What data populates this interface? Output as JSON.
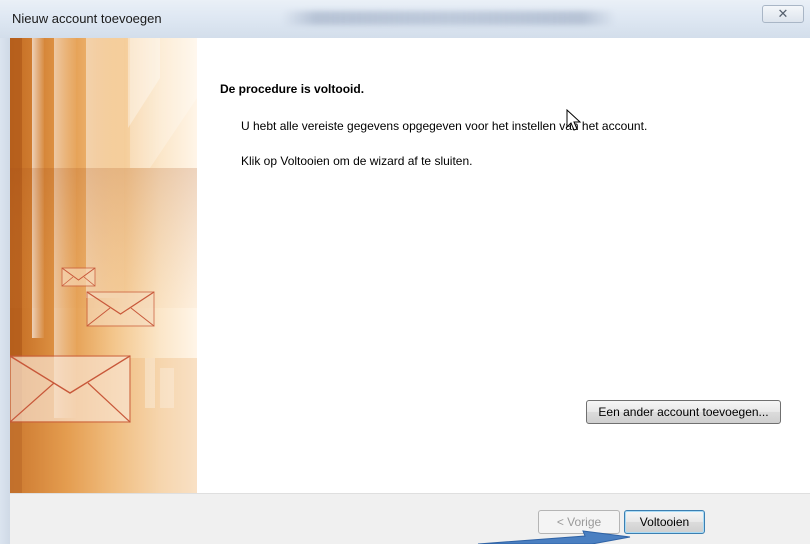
{
  "window": {
    "title": "Nieuw account toevoegen",
    "close_glyph": "✕",
    "close_icon": "close-icon"
  },
  "main": {
    "heading": "De procedure is voltooid.",
    "paragraph_1": "U hebt alle vereiste gegevens opgegeven voor het instellen van het account.",
    "paragraph_2": "Klik op Voltooien om de wizard af te sluiten.",
    "add_account_button": "Een ander account toevoegen..."
  },
  "footer": {
    "back_button": "< Vorige",
    "finish_button": "Voltooien"
  },
  "colors": {
    "annotation_arrow": "#4a7fc1",
    "accent_orange": "#e39a4b",
    "envelope_stroke": "#c8583a"
  },
  "icons": {
    "cursor": "mouse-pointer-icon",
    "envelopes": "envelope-icon",
    "arrow": "annotation-arrow-icon"
  }
}
